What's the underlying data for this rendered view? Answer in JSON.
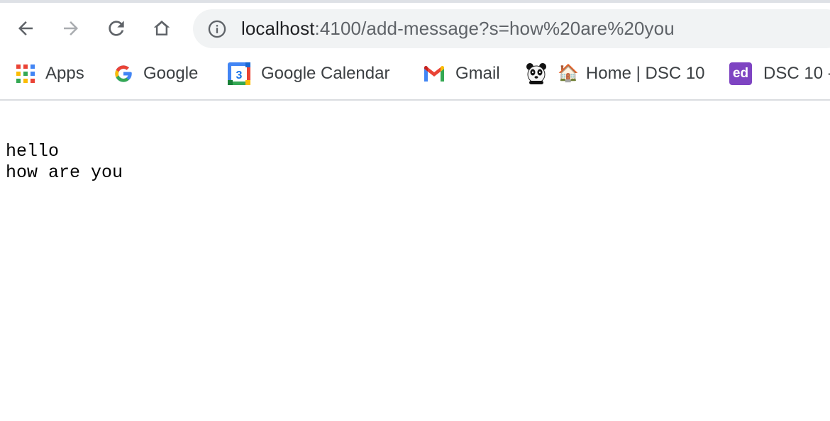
{
  "browser": {
    "url_host": "localhost",
    "url_rest": ":4100/add-message?s=how%20are%20you",
    "nav": {
      "back_icon": "arrow-left-icon",
      "forward_icon": "arrow-right-icon",
      "reload_icon": "reload-icon",
      "home_icon": "home-icon",
      "info_icon": "info-icon"
    }
  },
  "bookmarks": [
    {
      "label": "Apps",
      "icon": "apps-grid-icon"
    },
    {
      "label": "Google",
      "icon": "google-g-icon"
    },
    {
      "label": "Google Calendar",
      "icon": "google-calendar-icon",
      "icon_text": "3"
    },
    {
      "label": "Gmail",
      "icon": "gmail-icon"
    },
    {
      "label": "",
      "icon": "panda-icon"
    },
    {
      "label": "Home | DSC 10",
      "icon": "house-icon",
      "emoji": "🏠"
    },
    {
      "label": "DSC 10 -",
      "icon": "ed-icon",
      "icon_text": "ed"
    }
  ],
  "page": {
    "lines": [
      "hello",
      "how are you"
    ]
  },
  "colors": {
    "toolbar_bg": "#ffffff",
    "omnibox_bg": "#f1f3f4",
    "icon_grey": "#5f6368",
    "ed_purple": "#7e44c2"
  }
}
